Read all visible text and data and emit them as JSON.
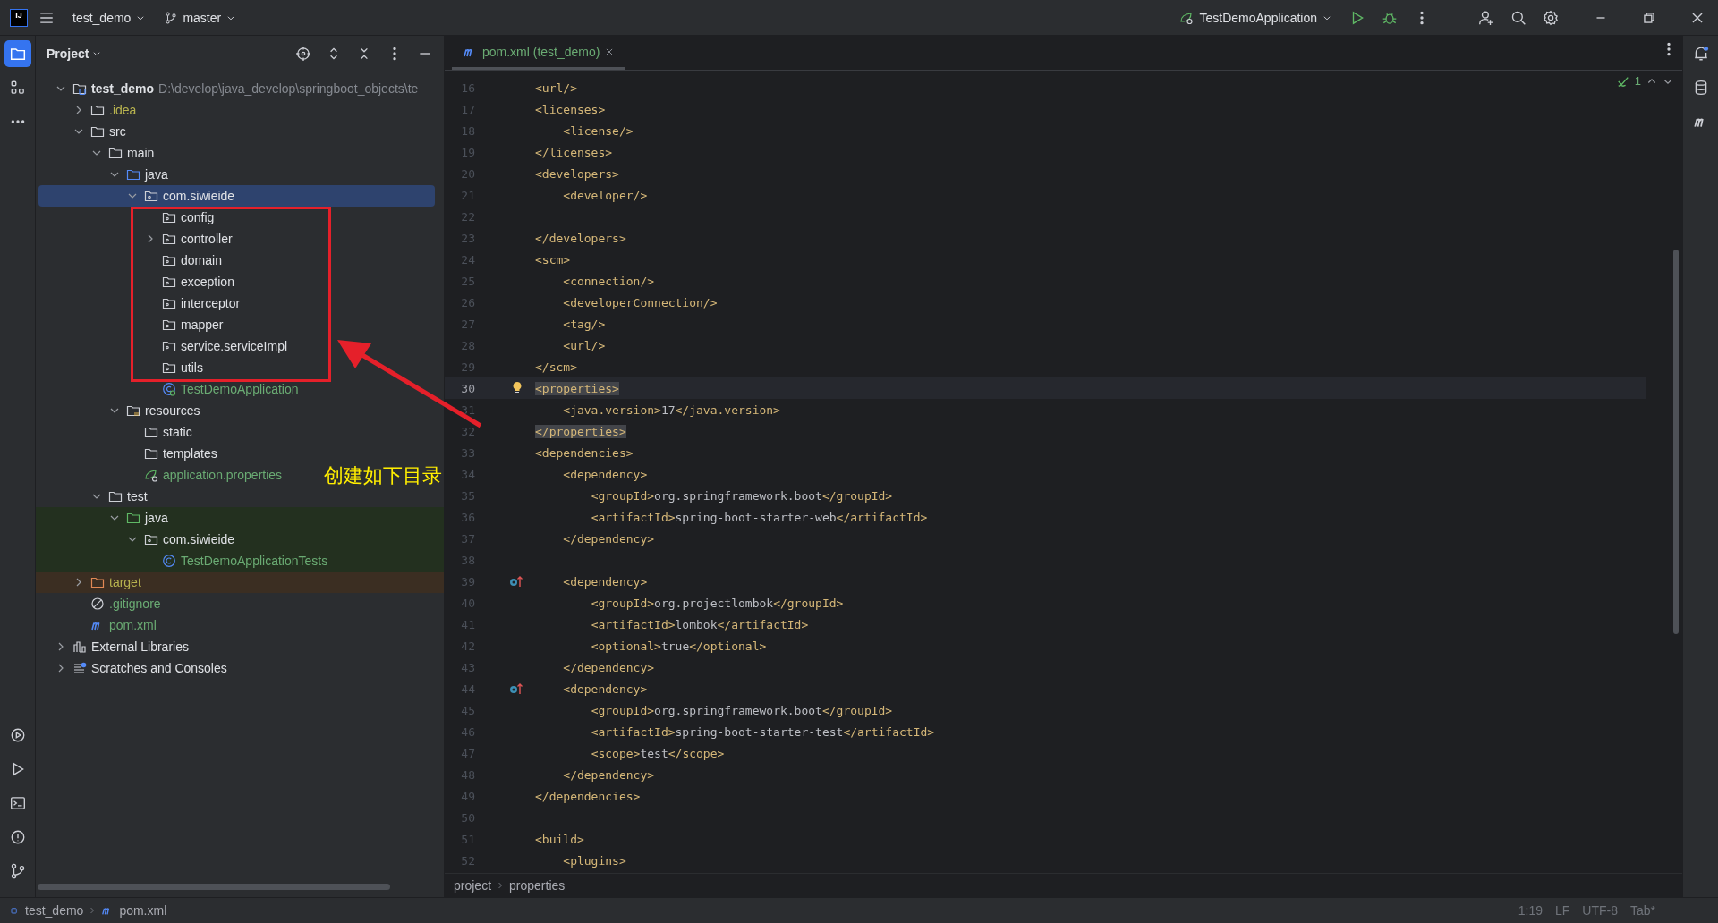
{
  "title_bar": {
    "logo": "IJ",
    "project": "test_demo",
    "branch": "master",
    "run_config": "TestDemoApplication"
  },
  "project_panel": {
    "title": "Project",
    "tree": [
      {
        "label": "test_demo",
        "path": "D:\\develop\\java_develop\\springboot_objects\\te",
        "kind": "module",
        "expanded": true,
        "selected": false,
        "children": [
          {
            "label": ".idea",
            "kind": "folder",
            "expanded": false,
            "selected": false,
            "color": "#b8b34f",
            "excluded": false
          },
          {
            "label": "src",
            "kind": "folder",
            "expanded": true,
            "selected": false,
            "excluded": false,
            "children": [
              {
                "label": "main",
                "kind": "folder",
                "expanded": true,
                "selected": false,
                "test_sources": false,
                "children": [
                  {
                    "label": "java",
                    "kind": "source-folder",
                    "expanded": true,
                    "selected": false,
                    "children": [
                      {
                        "label": "com.siwieide",
                        "kind": "package",
                        "expanded": true,
                        "selected": true,
                        "children": [
                          {
                            "label": "config",
                            "kind": "package",
                            "selected": false
                          },
                          {
                            "label": "controller",
                            "kind": "package",
                            "expanded": false,
                            "selected": false
                          },
                          {
                            "label": "domain",
                            "kind": "package",
                            "selected": false
                          },
                          {
                            "label": "exception",
                            "kind": "package",
                            "selected": false
                          },
                          {
                            "label": "interceptor",
                            "kind": "package",
                            "selected": false
                          },
                          {
                            "label": "mapper",
                            "kind": "package",
                            "selected": false
                          },
                          {
                            "label": "service.serviceImpl",
                            "kind": "package",
                            "selected": false
                          },
                          {
                            "label": "utils",
                            "kind": "package",
                            "selected": false
                          },
                          {
                            "label": "TestDemoApplication",
                            "kind": "boot-class",
                            "selected": false,
                            "color": "#6aab73"
                          }
                        ]
                      }
                    ]
                  },
                  {
                    "label": "resources",
                    "kind": "resources-folder",
                    "expanded": true,
                    "selected": false,
                    "test_sources": false,
                    "children": [
                      {
                        "label": "static",
                        "kind": "folder",
                        "selected": false
                      },
                      {
                        "label": "templates",
                        "kind": "folder",
                        "selected": false
                      },
                      {
                        "label": "application.properties",
                        "kind": "spring-config",
                        "selected": false,
                        "color": "#6aab73"
                      }
                    ]
                  }
                ]
              },
              {
                "label": "test",
                "kind": "folder",
                "expanded": true,
                "selected": false,
                "test_sources": false,
                "children": [
                  {
                    "label": "java",
                    "kind": "test-folder",
                    "expanded": true,
                    "selected": false,
                    "test_sources": true,
                    "children": [
                      {
                        "label": "com.siwieide",
                        "kind": "package",
                        "expanded": true,
                        "selected": false,
                        "test_sources": true,
                        "children": [
                          {
                            "label": "TestDemoApplicationTests",
                            "kind": "class",
                            "selected": false,
                            "color": "#6aab73",
                            "test_sources": true
                          }
                        ]
                      }
                    ]
                  }
                ]
              }
            ]
          },
          {
            "label": "target",
            "kind": "excluded-folder",
            "expanded": false,
            "selected": false,
            "color": "#b8b34f",
            "excluded": true
          },
          {
            "label": ".gitignore",
            "kind": "ignore-file",
            "selected": false,
            "color": "#6aab73",
            "excluded": false
          },
          {
            "label": "pom.xml",
            "kind": "maven",
            "selected": false,
            "color": "#6aab73",
            "excluded": false
          }
        ]
      },
      {
        "label": "External Libraries",
        "kind": "library",
        "expanded": false,
        "selected": false
      },
      {
        "label": "Scratches and Consoles",
        "kind": "scratches",
        "expanded": false,
        "selected": false
      }
    ]
  },
  "editor": {
    "tabs": [
      {
        "label": "pom.xml (test_demo)",
        "selected": true
      }
    ],
    "inspection_count": "1",
    "lines": [
      {
        "n": "16",
        "text": "<url/>"
      },
      {
        "n": "17",
        "text": "<licenses>"
      },
      {
        "n": "18",
        "text": "    <license/>"
      },
      {
        "n": "19",
        "text": "</licenses>"
      },
      {
        "n": "20",
        "text": "<developers>"
      },
      {
        "n": "21",
        "text": "    <developer/>"
      },
      {
        "n": "22"
      },
      {
        "n": "23",
        "text": "</developers>"
      },
      {
        "n": "24",
        "text": "<scm>"
      },
      {
        "n": "25",
        "text": "    <connection/>"
      },
      {
        "n": "26",
        "text": "    <developerConnection/>"
      },
      {
        "n": "27",
        "text": "    <tag/>"
      },
      {
        "n": "28",
        "text": "    <url/>"
      },
      {
        "n": "29",
        "text": "</scm>"
      },
      {
        "n": "30",
        "text": "<properties>",
        "current": true,
        "matched": true,
        "kind": "bulb"
      },
      {
        "n": "31",
        "text": "    <java.version>17</java.version>"
      },
      {
        "n": "32",
        "text": "</properties>",
        "matched": true
      },
      {
        "n": "33",
        "text": "<dependencies>"
      },
      {
        "n": "34",
        "text": "    <dependency>"
      },
      {
        "n": "35",
        "text": "        <groupId>org.springframework.boot</groupId>"
      },
      {
        "n": "36",
        "text": "        <artifactId>spring-boot-starter-web</artifactId>"
      },
      {
        "n": "37",
        "text": "    </dependency>"
      },
      {
        "n": "38"
      },
      {
        "n": "39",
        "text": "    <dependency>",
        "kind": "override"
      },
      {
        "n": "40",
        "text": "        <groupId>org.projectlombok</groupId>"
      },
      {
        "n": "41",
        "text": "        <artifactId>lombok</artifactId>"
      },
      {
        "n": "42",
        "text": "        <optional>true</optional>"
      },
      {
        "n": "43",
        "text": "    </dependency>"
      },
      {
        "n": "44",
        "text": "    <dependency>",
        "kind": "override"
      },
      {
        "n": "45",
        "text": "        <groupId>org.springframework.boot</groupId>"
      },
      {
        "n": "46",
        "text": "        <artifactId>spring-boot-starter-test</artifactId>"
      },
      {
        "n": "47",
        "text": "        <scope>test</scope>"
      },
      {
        "n": "48",
        "text": "    </dependency>"
      },
      {
        "n": "49",
        "text": "</dependencies>"
      },
      {
        "n": "50"
      },
      {
        "n": "51",
        "text": "<build>"
      },
      {
        "n": "52",
        "text": "    <plugins>"
      }
    ],
    "breadcrumbs": [
      "project",
      "properties"
    ]
  },
  "annotation": {
    "text": "创建如下目录"
  },
  "status_bar": {
    "path": [
      "test_demo",
      "pom.xml"
    ],
    "right": [
      "1:19",
      "LF",
      "UTF-8",
      "Tab*"
    ]
  }
}
